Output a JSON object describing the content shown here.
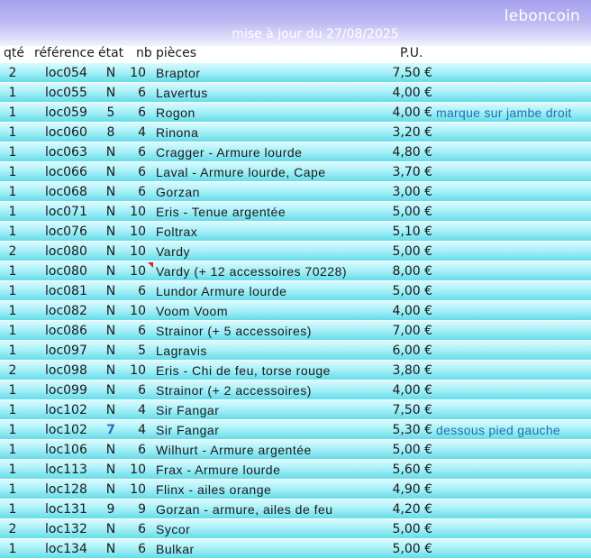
{
  "brand": "leboncoin",
  "update_text": "mise à jour du 27/08/2025",
  "headers": {
    "qte": "qté",
    "ref": "référence",
    "etat": "état",
    "nb": "nb",
    "pieces": "pièces",
    "pu": "P.U."
  },
  "rows": [
    {
      "qte": "2",
      "ref": "loc054",
      "etat": "N",
      "nb": "10",
      "piece": "Braptor",
      "pu": "7,50 €",
      "note": ""
    },
    {
      "qte": "1",
      "ref": "loc055",
      "etat": "N",
      "nb": "6",
      "piece": "Lavertus",
      "pu": "4,00 €",
      "note": ""
    },
    {
      "qte": "1",
      "ref": "loc059",
      "etat": "5",
      "nb": "6",
      "piece": "Rogon",
      "pu": "4,00 €",
      "note": "marque sur jambe droit"
    },
    {
      "qte": "1",
      "ref": "loc060",
      "etat": "8",
      "nb": "4",
      "piece": "Rinona",
      "pu": "3,20 €",
      "note": ""
    },
    {
      "qte": "1",
      "ref": "loc063",
      "etat": "N",
      "nb": "6",
      "piece": "Cragger - Armure lourde",
      "pu": "4,80 €",
      "note": ""
    },
    {
      "qte": "1",
      "ref": "loc066",
      "etat": "N",
      "nb": "6",
      "piece": "Laval - Armure lourde, Cape",
      "pu": "3,70 €",
      "note": ""
    },
    {
      "qte": "1",
      "ref": "loc068",
      "etat": "N",
      "nb": "6",
      "piece": "Gorzan",
      "pu": "3,00 €",
      "note": ""
    },
    {
      "qte": "1",
      "ref": "loc071",
      "etat": "N",
      "nb": "10",
      "piece": "Eris - Tenue argentée",
      "pu": "5,00 €",
      "note": ""
    },
    {
      "qte": "1",
      "ref": "loc076",
      "etat": "N",
      "nb": "10",
      "piece": "Foltrax",
      "pu": "5,10 €",
      "note": ""
    },
    {
      "qte": "2",
      "ref": "loc080",
      "etat": "N",
      "nb": "10",
      "piece": "Vardy",
      "pu": "5,00 €",
      "note": ""
    },
    {
      "qte": "1",
      "ref": "loc080",
      "etat": "N",
      "nb": "10",
      "piece": "Vardy (+ 12 accessoires 70228)",
      "pu": "8,00 €",
      "note": "",
      "flag": true
    },
    {
      "qte": "1",
      "ref": "loc081",
      "etat": "N",
      "nb": "6",
      "piece": "Lundor Armure lourde",
      "pu": "5,00 €",
      "note": ""
    },
    {
      "qte": "1",
      "ref": "loc082",
      "etat": "N",
      "nb": "10",
      "piece": "Voom Voom",
      "pu": "4,00 €",
      "note": ""
    },
    {
      "qte": "1",
      "ref": "loc086",
      "etat": "N",
      "nb": "6",
      "piece": "Strainor (+ 5 accessoires)",
      "pu": "7,00 €",
      "note": ""
    },
    {
      "qte": "1",
      "ref": "loc097",
      "etat": "N",
      "nb": "5",
      "piece": "Lagravis",
      "pu": "6,00 €",
      "note": ""
    },
    {
      "qte": "2",
      "ref": "loc098",
      "etat": "N",
      "nb": "10",
      "piece": "Eris - Chi de feu, torse rouge",
      "pu": "3,80 €",
      "note": ""
    },
    {
      "qte": "1",
      "ref": "loc099",
      "etat": "N",
      "nb": "6",
      "piece": "Strainor (+ 2 accessoires)",
      "pu": "4,00 €",
      "note": ""
    },
    {
      "qte": "1",
      "ref": "loc102",
      "etat": "N",
      "nb": "4",
      "piece": "Sir Fangar",
      "pu": "7,50 €",
      "note": ""
    },
    {
      "qte": "1",
      "ref": "loc102",
      "etat": "7",
      "nb": "4",
      "piece": "Sir Fangar",
      "pu": "5,30 €",
      "note": "dessous pied gauche",
      "etat_highlight": true
    },
    {
      "qte": "1",
      "ref": "loc106",
      "etat": "N",
      "nb": "6",
      "piece": "Wilhurt - Armure argentée",
      "pu": "5,00 €",
      "note": ""
    },
    {
      "qte": "1",
      "ref": "loc113",
      "etat": "N",
      "nb": "10",
      "piece": "Frax - Armure lourde",
      "pu": "5,60 €",
      "note": ""
    },
    {
      "qte": "1",
      "ref": "loc128",
      "etat": "N",
      "nb": "10",
      "piece": "Flinx - ailes orange",
      "pu": "4,90 €",
      "note": ""
    },
    {
      "qte": "1",
      "ref": "loc131",
      "etat": "9",
      "nb": "9",
      "piece": "Gorzan - armure, ailes de feu",
      "pu": "4,20 €",
      "note": ""
    },
    {
      "qte": "2",
      "ref": "loc132",
      "etat": "N",
      "nb": "6",
      "piece": "Sycor",
      "pu": "5,00 €",
      "note": ""
    },
    {
      "qte": "1",
      "ref": "loc134",
      "etat": "N",
      "nb": "6",
      "piece": "Bulkar",
      "pu": "5,00 €",
      "note": ""
    }
  ]
}
